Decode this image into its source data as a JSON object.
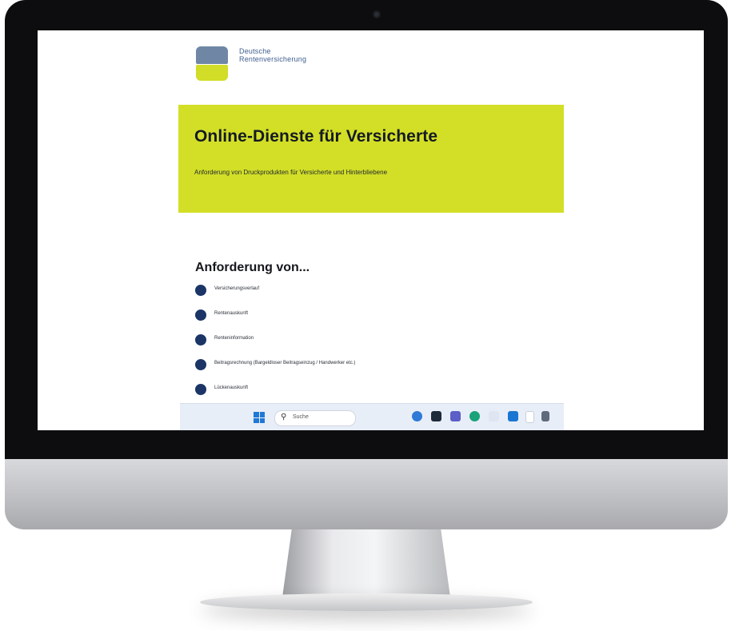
{
  "logo": {
    "line1": "Deutsche",
    "line2": "Rentenversicherung"
  },
  "banner": {
    "title": "Online-Dienste für Versicherte",
    "subtitle": "Anforderung von Druckprodukten für Versicherte und Hinterbliebene"
  },
  "section": {
    "title": "Anforderung von..."
  },
  "items": [
    "Versicherungsverlauf",
    "Rentenauskunft",
    "Renteninformation",
    "Beitragsrechnung (Bargeldloser Beitragseinzug / Handwerker etc.)",
    "Lückenauskunft"
  ],
  "taskbar": {
    "search_placeholder": "Suche",
    "icons": [
      "windows-start-icon",
      "search-icon",
      "copilot-icon",
      "file-explorer-icon",
      "teams-icon",
      "edge-icon",
      "store-icon",
      "mail-icon",
      "password-icon",
      "calculator-icon"
    ]
  },
  "colors": {
    "brand_blue": "#1b3567",
    "brand_lime": "#d3df27",
    "logo_slate": "#6f87a5"
  }
}
